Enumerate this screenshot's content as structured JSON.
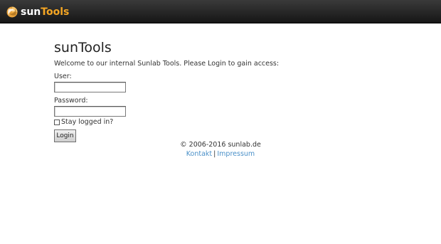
{
  "brand": {
    "logo_sun": "sun",
    "logo_tools": "Tools",
    "accent_color": "#f5a623"
  },
  "login": {
    "title": "sunTools",
    "welcome": "Welcome to our internal Sunlab Tools. Please Login to gain access:",
    "user_label": "User:",
    "user_value": "",
    "password_label": "Password:",
    "password_value": "",
    "stay_logged_in_label": "Stay logged in?",
    "stay_logged_in_checked": false,
    "login_button": "Login"
  },
  "footer": {
    "copyright": "© 2006-2016 sunlab.de",
    "links": [
      {
        "label": "Kontakt"
      },
      {
        "label": "Impressum"
      }
    ],
    "separator": "|",
    "link_color": "#4a90c8"
  }
}
